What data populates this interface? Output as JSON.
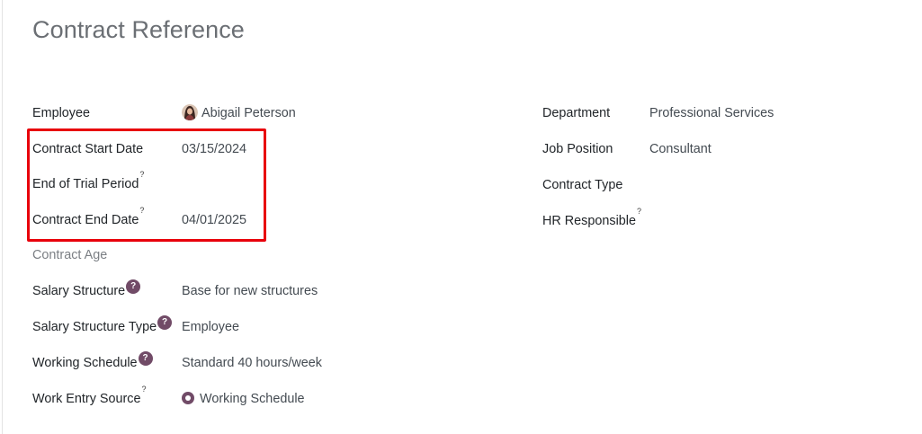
{
  "form": {
    "title": "Contract Reference"
  },
  "left_fields": {
    "employee": {
      "label": "Employee",
      "value": "Abigail Peterson"
    },
    "contract_start_date": {
      "label": "Contract Start Date",
      "value": "03/15/2024"
    },
    "end_of_trial_period": {
      "label": "End of Trial Period",
      "help": "?",
      "value": ""
    },
    "contract_end_date": {
      "label": "Contract End Date",
      "help": "?",
      "value": "04/01/2025"
    },
    "contract_age": {
      "label": "Contract Age",
      "value": ""
    },
    "salary_structure": {
      "label": "Salary Structure",
      "help": "?",
      "value": "Base for new structures"
    },
    "salary_structure_type": {
      "label": "Salary Structure Type",
      "help": "?",
      "value": "Employee"
    },
    "working_schedule": {
      "label": "Working Schedule",
      "help": "?",
      "value": "Standard 40 hours/week"
    },
    "work_entry_source": {
      "label": "Work Entry Source",
      "help": "?",
      "value": "Working Schedule"
    }
  },
  "right_fields": {
    "department": {
      "label": "Department",
      "value": "Professional Services"
    },
    "job_position": {
      "label": "Job Position",
      "value": "Consultant"
    },
    "contract_type": {
      "label": "Contract Type",
      "value": ""
    },
    "hr_responsible": {
      "label": "HR Responsible",
      "help": "?",
      "value": ""
    }
  },
  "icons": {
    "avatar": "employee-avatar-icon",
    "radio": "radio-selected-icon"
  },
  "colors": {
    "accent": "#714b67",
    "highlight_border": "#e8000b",
    "title_text": "#6b6f74",
    "label_text": "#212529",
    "value_text": "#444b52"
  }
}
